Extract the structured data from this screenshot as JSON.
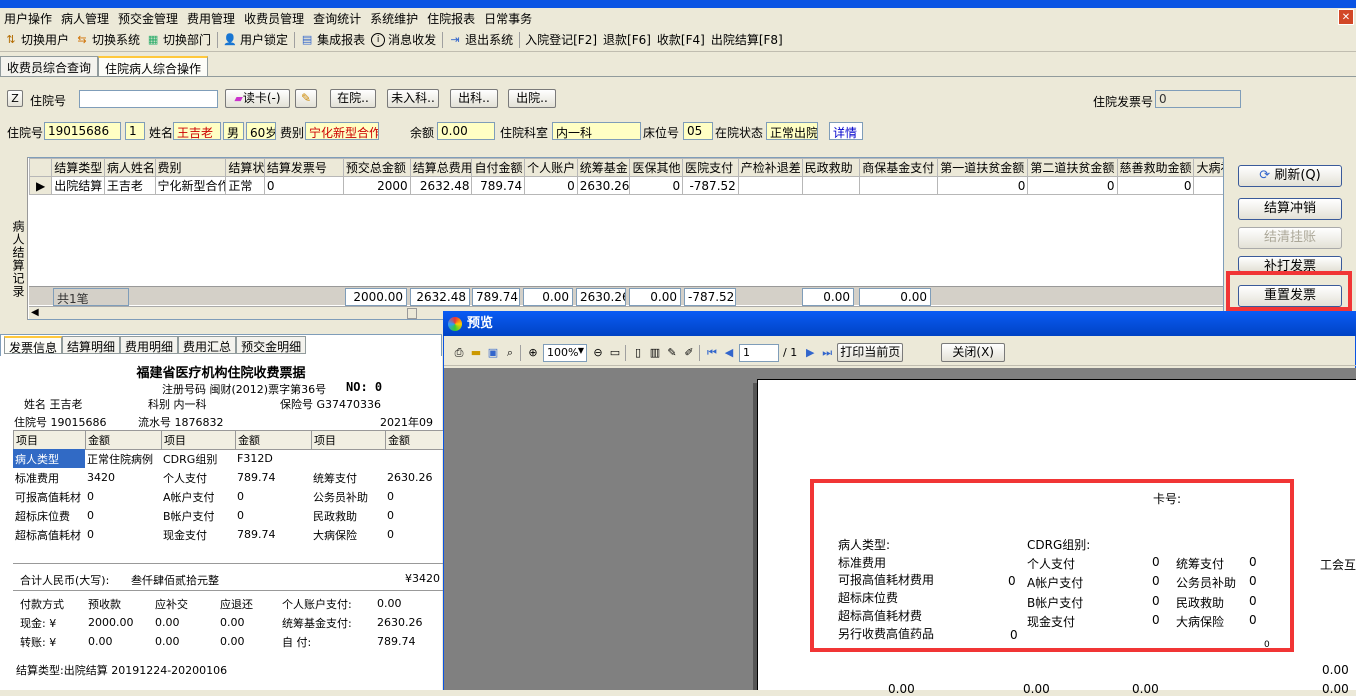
{
  "menu": [
    "用户操作",
    "病人管理",
    "预交金管理",
    "费用管理",
    "收费员管理",
    "查询统计",
    "系统维护",
    "住院报表",
    "日常事务"
  ],
  "toolbar": [
    {
      "icon": "switch-user-icon",
      "label": "切换用户"
    },
    {
      "icon": "switch-system-icon",
      "label": "切换系统"
    },
    {
      "icon": "switch-dept-icon",
      "label": "切换部门"
    },
    {
      "icon": "user-lock-icon",
      "label": "用户锁定"
    },
    {
      "icon": "report-icon",
      "label": "集成报表"
    },
    {
      "icon": "info-icon",
      "label": "消息收发"
    },
    {
      "icon": "exit-icon",
      "label": "退出系统"
    },
    {
      "icon": "",
      "label": "入院登记[F2]"
    },
    {
      "icon": "",
      "label": "退款[F6]"
    },
    {
      "icon": "",
      "label": "收款[F4]"
    },
    {
      "icon": "",
      "label": "出院结算[F8]"
    }
  ],
  "tabs": [
    "收费员综合查询",
    "住院病人综合操作"
  ],
  "search": {
    "z_label": "Z",
    "inpatient_label": "住院号",
    "read_card": "读卡(-)",
    "btn_inhosp": "在院..",
    "btn_notadmitted": "未入科..",
    "btn_leftdept": "出科..",
    "btn_discharged": "出院..",
    "invoice_no_label": "住院发票号",
    "invoice_no": "0"
  },
  "patient": {
    "id_label": "住院号",
    "id": "19015686",
    "bed_seq": "1",
    "name_label": "姓名",
    "name": "王吉老",
    "sex": "男",
    "age": "60岁",
    "fee_label": "费别",
    "fee_type": "宁化新型合作",
    "balance_label": "余额",
    "balance": "0.00",
    "dept_label": "住院科室",
    "dept": "内一科",
    "bed_label": "床位号",
    "bed": "05",
    "status_label": "在院状态",
    "status": "正常出院",
    "detail": "详情"
  },
  "grid": {
    "side_label": "病人结算记录",
    "headers": [
      "结算类型",
      "病人姓名",
      "费别",
      "结算状",
      "结算发票号",
      "预交总金额",
      "结算总费用",
      "自付金额",
      "个人账户",
      "统筹基金",
      "医保其他",
      "医院支付",
      "产检补退差",
      "民政救助",
      "商保基金支付",
      "第一道扶贫金额",
      "第二道扶贫金额",
      "慈善救助金额",
      "大病补"
    ],
    "row": [
      "出院结算",
      "王吉老",
      "宁化新型合作",
      "正常",
      "0",
      "2000",
      "2632.48",
      "789.74",
      "0",
      "2630.26",
      "0",
      "-787.52",
      "",
      "",
      "",
      "0",
      "0",
      "0",
      ""
    ],
    "sum_label": "共1笔",
    "sums": [
      "2000.00",
      "2632.48",
      "789.74",
      "0.00",
      "2630.26",
      "0.00",
      "-787.52",
      "",
      "0.00",
      "0.00"
    ]
  },
  "actions": {
    "refresh": "刷新(Q)",
    "reverse": "结算冲销",
    "clear": "结清挂账",
    "reprint": "补打发票",
    "reset": "重置发票"
  },
  "btabs": [
    "发票信息",
    "结算明细",
    "费用明细",
    "费用汇总",
    "预交金明细"
  ],
  "receipt": {
    "title": "福建省医疗机构住院收费票据",
    "reg": "注册号码 闽财(2012)票字第36号",
    "no_label": "NO: 0",
    "name_line": "姓名 王吉老",
    "dept_line": "科别 内一科",
    "ins_line": "保险号 G37470336",
    "id_line": "住院号 19015686",
    "serial_line": "流水号 1876832",
    "date": "2021年09月",
    "head": [
      "项目",
      "金额",
      "项目",
      "金额",
      "项目",
      "金额"
    ],
    "rows": [
      [
        "病人类型",
        "正常住院病例",
        "CDRG组别",
        "F312D",
        "",
        ""
      ],
      [
        "标准费用",
        "3420",
        "个人支付",
        "789.74",
        "统筹支付",
        "2630.26"
      ],
      [
        "可报高值耗材",
        "0",
        "A帐户支付",
        "0",
        "公务员补助",
        "0"
      ],
      [
        "超标床位费",
        "0",
        "B帐户支付",
        "0",
        "民政救助",
        "0"
      ],
      [
        "超标高值耗材",
        "0",
        "现金支付",
        "789.74",
        "大病保险",
        "0"
      ]
    ],
    "total_label": "合计人民币(大写):",
    "total_cn": "叁仟肆佰贰拾元整",
    "total_num": "¥3420",
    "pay_head": [
      "付款方式",
      "预收款",
      "应补交",
      "应退还",
      "个人账户支付:",
      "0.00"
    ],
    "pay_cash": [
      "现金: ¥",
      "2000.00",
      "0.00",
      "0.00",
      "统筹基金支付:",
      "2630.26"
    ],
    "pay_transfer": [
      "转账: ¥",
      "0.00",
      "0.00",
      "0.00",
      "自          付:",
      "789.74"
    ],
    "settle_line": "结算类型:出院结算 20191224-20200106"
  },
  "preview": {
    "title": "预览",
    "zoom": "100%",
    "page": "1",
    "page_total": "/ 1",
    "print_btn": "打印当前页",
    "close_btn": "关闭(X)",
    "card_label": "卡号:",
    "left_items": [
      "病人类型:",
      "标准费用",
      "可报高值耗材费用",
      "超标床位费",
      "超标高值耗材费",
      "另行收费高值药品"
    ],
    "left_vals": [
      "",
      "",
      "0",
      "",
      "",
      "0"
    ],
    "cdrg": "CDRG组别:",
    "mid_items": [
      "个人支付",
      "A帐户支付",
      "B帐户支付",
      "现金支付"
    ],
    "mid_vals": [
      "0",
      "0",
      "0",
      "0"
    ],
    "right_items": [
      "统筹支付",
      "公务员补助",
      "民政救助",
      "大病保险"
    ],
    "right_vals": [
      "0",
      "0",
      "0",
      "0"
    ],
    "far_right": "工会互",
    "zero": "0",
    "bottom_vals": [
      "0.00",
      "0.00",
      "0.00",
      "0.00",
      "0.00"
    ]
  }
}
